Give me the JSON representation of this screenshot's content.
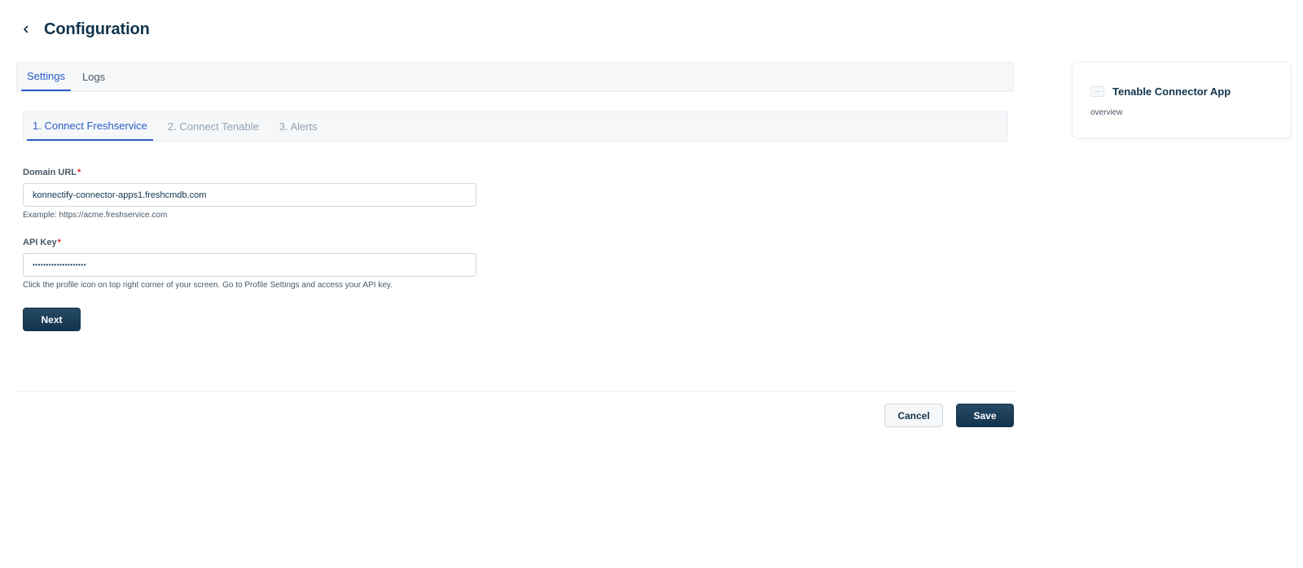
{
  "header": {
    "back_icon": "chevron-left-icon",
    "title": "Configuration"
  },
  "top_tabs": [
    {
      "label": "Settings",
      "active": true
    },
    {
      "label": "Logs",
      "active": false
    }
  ],
  "steps": [
    {
      "label": "1. Connect Freshservice",
      "active": true
    },
    {
      "label": "2. Connect Tenable",
      "active": false
    },
    {
      "label": "3. Alerts",
      "active": false
    }
  ],
  "form": {
    "domain": {
      "label": "Domain URL",
      "required_mark": "*",
      "value": "konnectify-connector-apps1.freshcmdb.com",
      "hint": "Example: https://acme.freshservice.com"
    },
    "api_key": {
      "label": "API Key",
      "required_mark": "*",
      "value": "••••••••••••••••••••",
      "hint": "Click the profile icon on top right corner of your screen. Go to Profile Settings and access your API key."
    },
    "next_label": "Next"
  },
  "footer": {
    "cancel_label": "Cancel",
    "save_label": "Save"
  },
  "app_card": {
    "logo_icon": "app-logo-icon",
    "name": "Tenable Connector App",
    "subtitle": "overview"
  },
  "colors": {
    "accent": "#2c5cc5",
    "primary_button": "#12344d",
    "required": "#d72d30"
  }
}
